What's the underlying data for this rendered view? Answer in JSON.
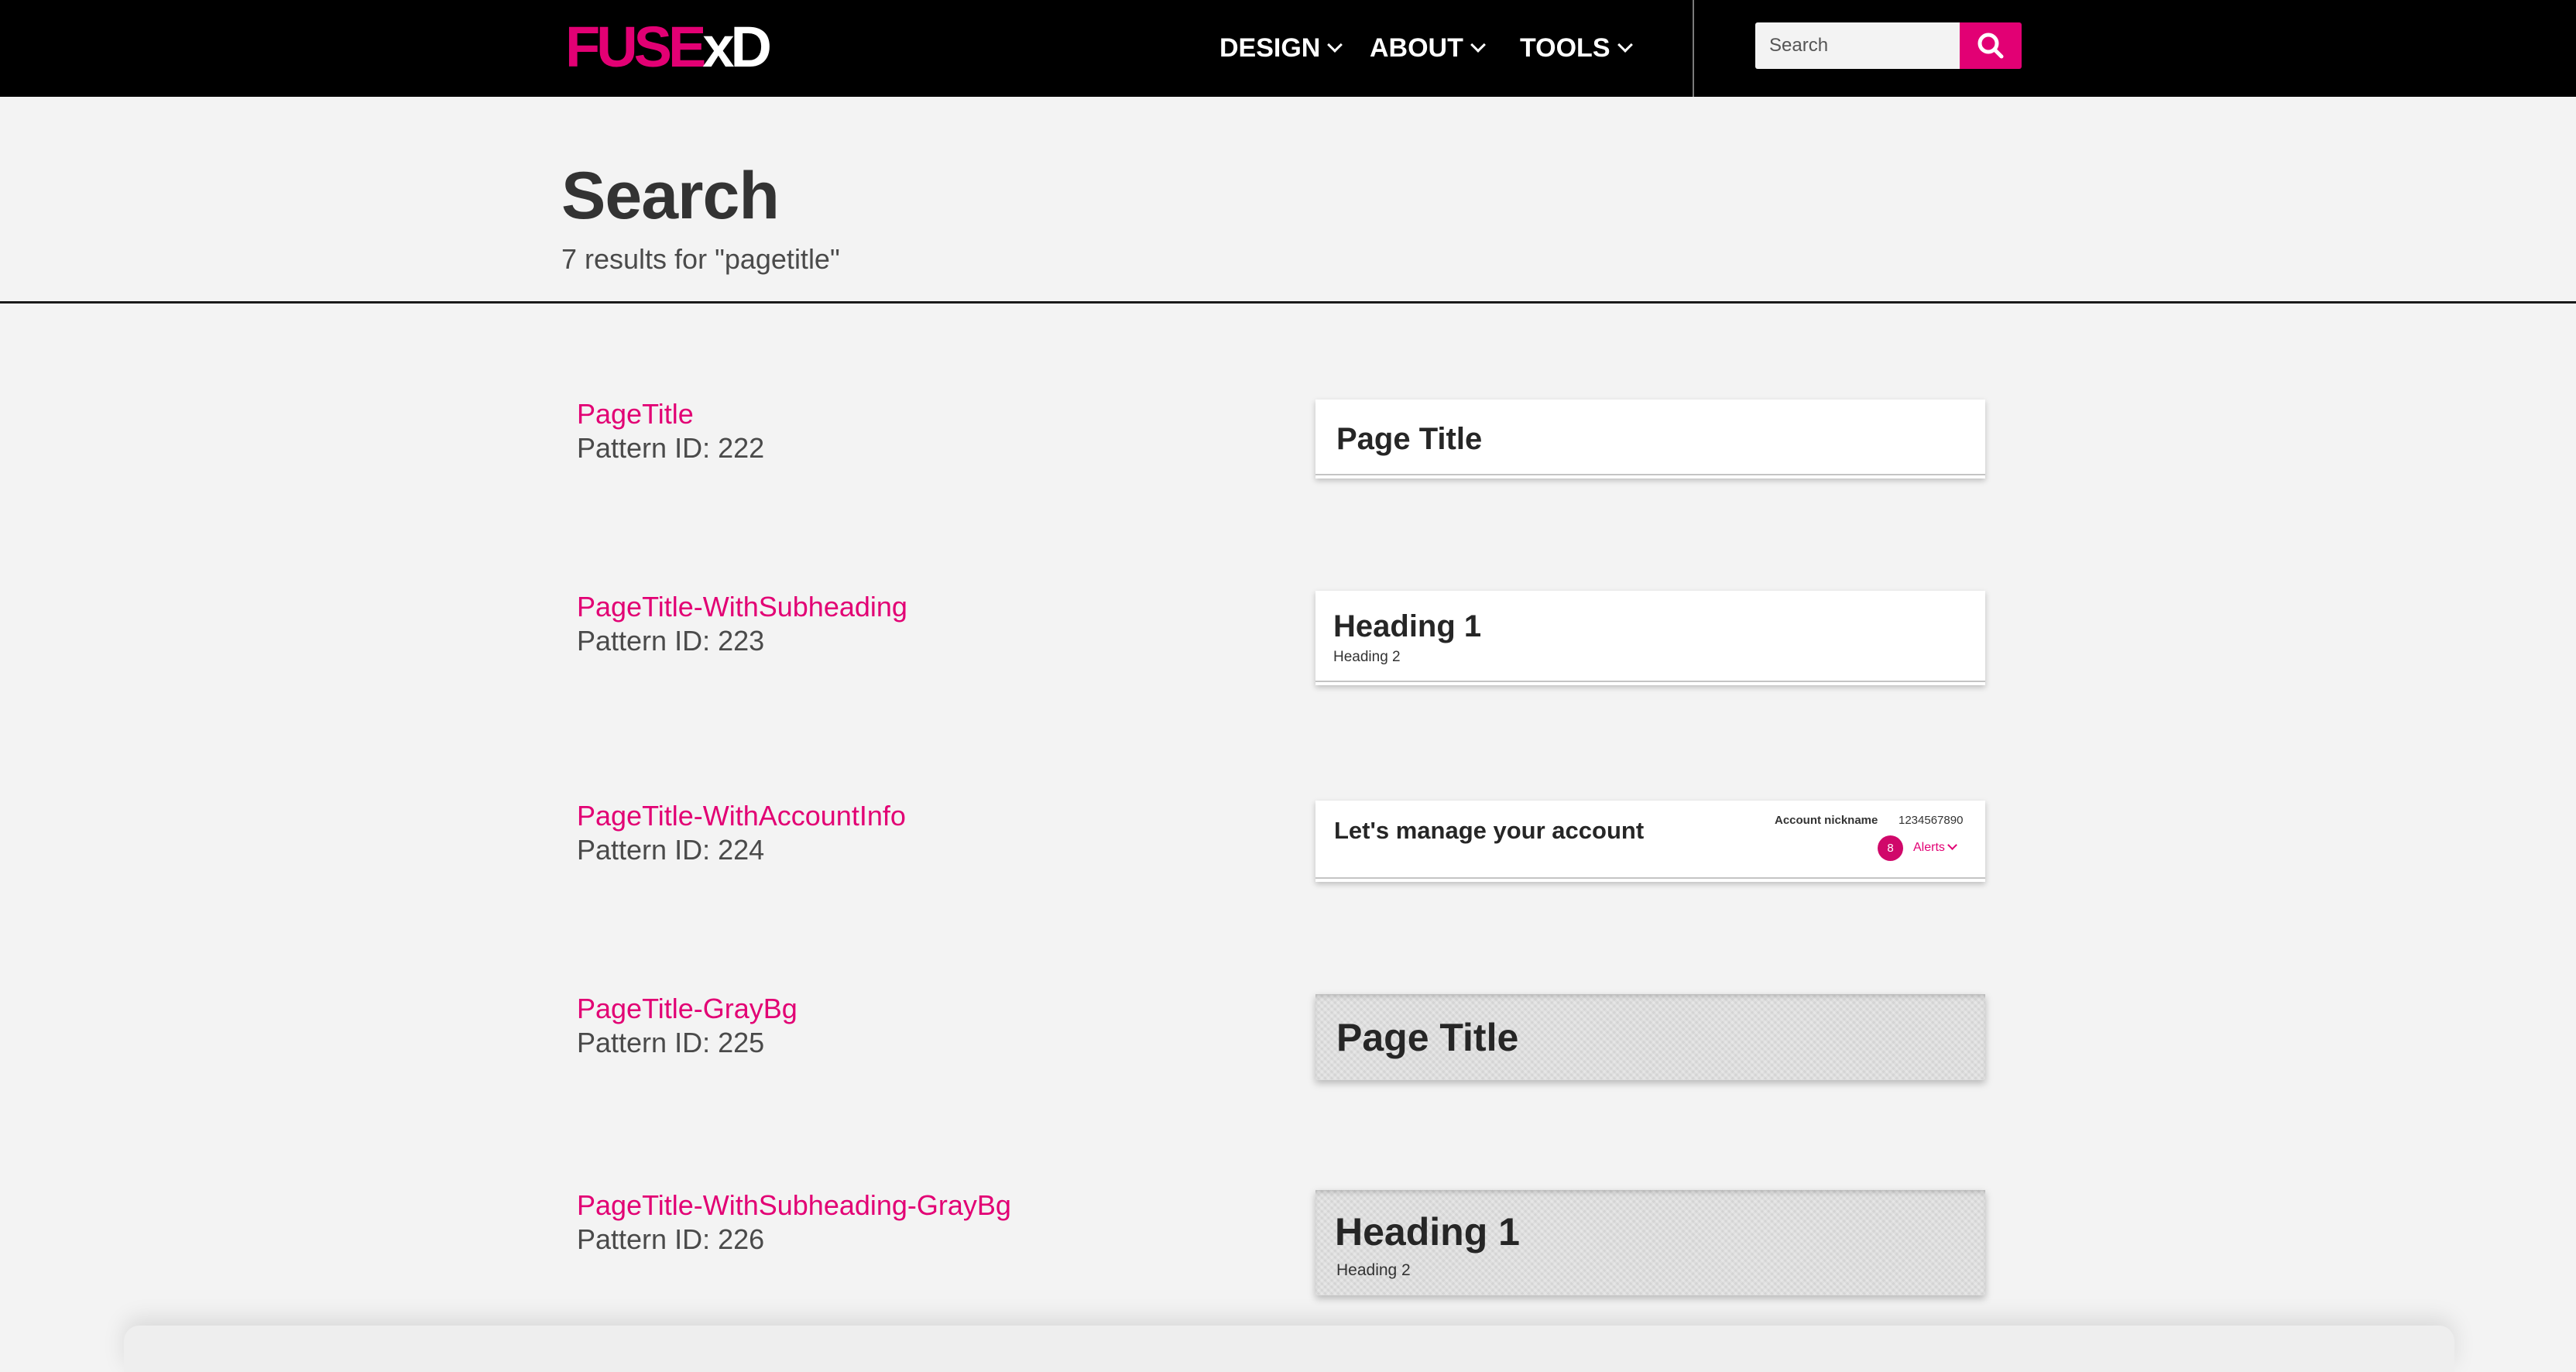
{
  "header": {
    "logo": {
      "part1": "FUSE",
      "part2": "xD"
    },
    "nav": [
      {
        "label": "DESIGN"
      },
      {
        "label": "ABOUT"
      },
      {
        "label": "TOOLS"
      }
    ],
    "search": {
      "placeholder": "Search",
      "button_icon": "search-icon"
    }
  },
  "page": {
    "title": "Search",
    "results_text": "7 results for \"pagetitle\""
  },
  "results": [
    {
      "name": "PageTitle",
      "pattern_id": "Pattern ID: 222",
      "preview": {
        "title": "Page Title"
      }
    },
    {
      "name": "PageTitle-WithSubheading",
      "pattern_id": "Pattern ID: 223",
      "preview": {
        "title": "Heading 1",
        "subtitle": "Heading 2"
      }
    },
    {
      "name": "PageTitle-WithAccountInfo",
      "pattern_id": "Pattern ID: 224",
      "preview": {
        "title": "Let's manage your account",
        "account_label": "Account nickname",
        "account_number": "1234567890",
        "alerts_count": "8",
        "alerts_label": "Alerts"
      }
    },
    {
      "name": "PageTitle-GrayBg",
      "pattern_id": "Pattern ID: 225",
      "preview": {
        "title": "Page Title"
      }
    },
    {
      "name": "PageTitle-WithSubheading-GrayBg",
      "pattern_id": "Pattern ID: 226",
      "preview": {
        "title": "Heading 1",
        "subtitle": "Heading 2"
      }
    }
  ],
  "colors": {
    "brand": "#e20074",
    "topbar": "#000000",
    "page_bg": "#f3f3f3"
  }
}
